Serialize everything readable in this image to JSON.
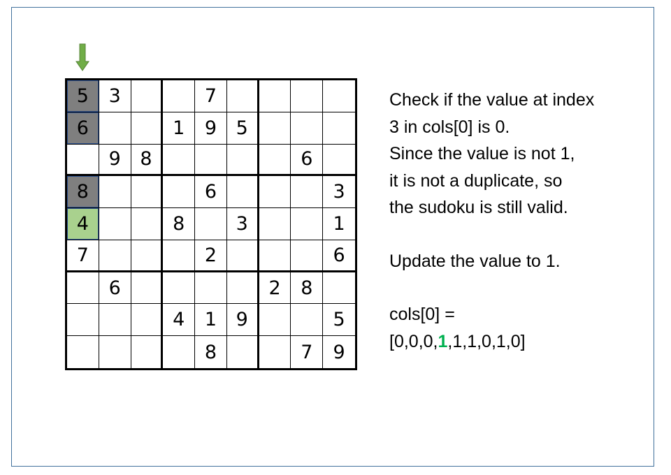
{
  "board": [
    [
      "5",
      "3",
      "",
      "",
      "7",
      "",
      "",
      "",
      ""
    ],
    [
      "6",
      "",
      "",
      "1",
      "9",
      "5",
      "",
      "",
      ""
    ],
    [
      "",
      "9",
      "8",
      "",
      "",
      "",
      "",
      "6",
      ""
    ],
    [
      "8",
      "",
      "",
      "",
      "6",
      "",
      "",
      "",
      "3"
    ],
    [
      "4",
      "",
      "",
      "8",
      "",
      "3",
      "",
      "",
      "1"
    ],
    [
      "7",
      "",
      "",
      "",
      "2",
      "",
      "",
      "",
      "6"
    ],
    [
      "",
      "6",
      "",
      "",
      "",
      "",
      "2",
      "8",
      ""
    ],
    [
      "",
      "",
      "",
      "4",
      "1",
      "9",
      "",
      "",
      "5"
    ],
    [
      "",
      "",
      "",
      "",
      "8",
      "",
      "",
      "7",
      "9"
    ]
  ],
  "highlight": {
    "column": 0,
    "gray_rows": [
      0,
      1,
      3
    ],
    "green_row": 4,
    "gray_color": "#7f7f7f",
    "green_color": "#a9d18e",
    "arrow_color": "#70ad47"
  },
  "explanation": {
    "line1": "Check if the value at index",
    "line2": "3 in cols[0] is 0.",
    "line3": "Since the value is not 1,",
    "line4": "it is not a duplicate, so",
    "line5": "the sudoku is still valid.",
    "update_line": "Update the value to 1.",
    "cols_label": "cols[0] =",
    "cols_prefix": "[0,0,0,",
    "cols_highlight": "1",
    "cols_suffix": ",1,1,0,1,0]",
    "highlight_color": "#00b050"
  }
}
